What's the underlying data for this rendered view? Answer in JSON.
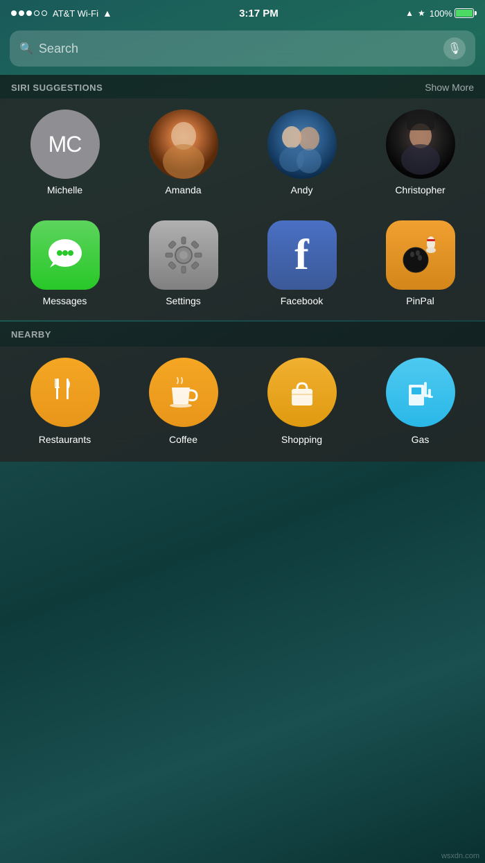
{
  "statusBar": {
    "carrier": "AT&T Wi-Fi",
    "time": "3:17 PM",
    "battery": "100%"
  },
  "search": {
    "placeholder": "Search"
  },
  "siriSuggestions": {
    "sectionTitle": "SIRI SUGGESTIONS",
    "showMore": "Show More",
    "contacts": [
      {
        "id": "michelle",
        "name": "Michelle",
        "initials": "MC",
        "type": "initials"
      },
      {
        "id": "amanda",
        "name": "Amanda",
        "initials": "",
        "type": "photo"
      },
      {
        "id": "andy",
        "name": "Andy",
        "initials": "",
        "type": "photo"
      },
      {
        "id": "christopher",
        "name": "Christopher",
        "initials": "",
        "type": "photo"
      }
    ]
  },
  "apps": {
    "items": [
      {
        "id": "messages",
        "name": "Messages"
      },
      {
        "id": "settings",
        "name": "Settings"
      },
      {
        "id": "facebook",
        "name": "Facebook"
      },
      {
        "id": "pinpal",
        "name": "PinPal"
      }
    ]
  },
  "nearby": {
    "sectionTitle": "NEARBY",
    "items": [
      {
        "id": "restaurants",
        "name": "Restaurants"
      },
      {
        "id": "coffee",
        "name": "Coffee"
      },
      {
        "id": "shopping",
        "name": "Shopping"
      },
      {
        "id": "gas",
        "name": "Gas"
      }
    ]
  },
  "watermark": "wsxdn.com"
}
